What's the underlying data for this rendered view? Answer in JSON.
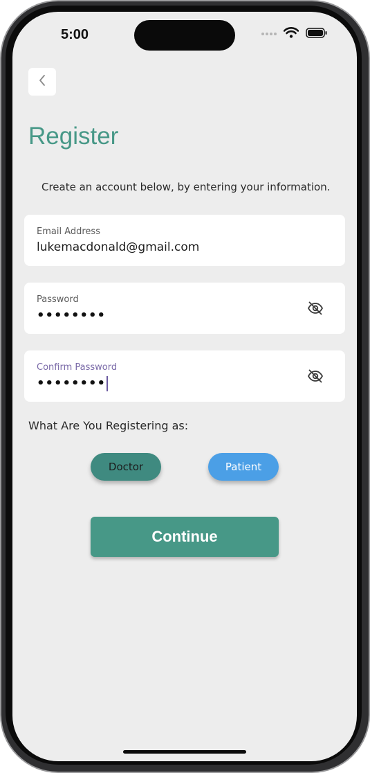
{
  "status_bar": {
    "time": "5:00"
  },
  "header": {
    "title": "Register"
  },
  "subtitle": "Create an account below, by entering your information.",
  "form": {
    "email": {
      "label": "Email Address",
      "value": "lukemacdonald@gmail.com"
    },
    "password": {
      "label": "Password",
      "value": "••••••••"
    },
    "confirm_password": {
      "label": "Confirm Password",
      "value": "••••••••"
    }
  },
  "role_question": "What Are You Registering as:",
  "roles": {
    "doctor": "Doctor",
    "patient": "Patient"
  },
  "continue_label": "Continue",
  "colors": {
    "accent": "#479887",
    "doctor_pill": "#3f8a80",
    "patient_pill": "#4b9fe6",
    "focused_label": "#7a6aa8"
  },
  "icons": {
    "back": "chevron-left-icon",
    "password_toggle": "eye-off-icon"
  }
}
